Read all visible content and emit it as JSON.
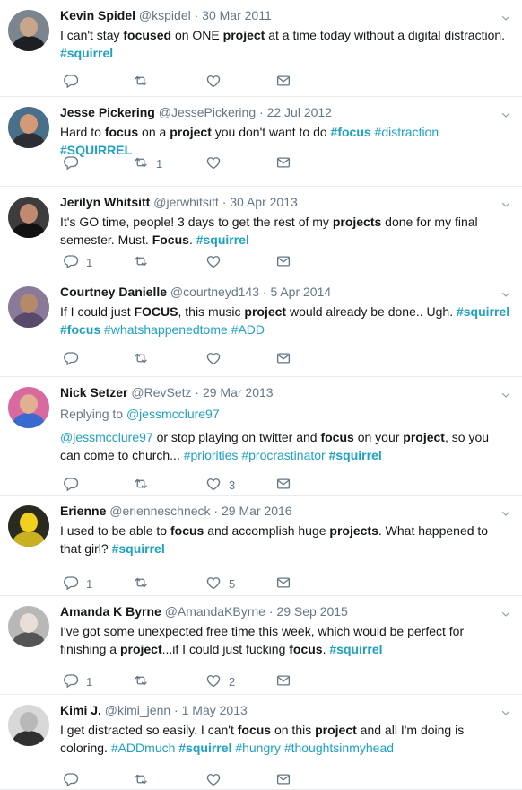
{
  "tweets": [
    {
      "name": "Kevin Spidel",
      "handle": "@kspidel",
      "date": "30 Mar 2011",
      "reply_to": "",
      "body": [
        {
          "t": "I can't stay "
        },
        {
          "t": "focused",
          "b": true
        },
        {
          "t": " on ONE "
        },
        {
          "t": "project",
          "b": true
        },
        {
          "t": " at a time today without a digital distraction. "
        },
        {
          "t": "#squirrel",
          "tag": true,
          "b": true
        }
      ],
      "replies": "",
      "retweets": "",
      "likes": "",
      "avatar": {
        "bg": "#7a8590",
        "face": "#c9a58a",
        "shoulders": "#1d1f22"
      }
    },
    {
      "name": "Jesse Pickering",
      "handle": "@JessePickering",
      "date": "22 Jul 2012",
      "reply_to": "",
      "body": [
        {
          "t": "Hard to "
        },
        {
          "t": "focus",
          "b": true
        },
        {
          "t": " on a "
        },
        {
          "t": "project",
          "b": true
        },
        {
          "t": " you don't want to do "
        },
        {
          "t": "#focus",
          "tag": true,
          "b": true
        },
        {
          "t": " "
        },
        {
          "t": "#distraction",
          "tag": true
        },
        {
          "t": " "
        },
        {
          "t": "#SQUIRREL",
          "tag": true,
          "b": true
        }
      ],
      "replies": "",
      "retweets": "1",
      "likes": "",
      "avatar": {
        "bg": "#4a6f8a",
        "face": "#d49a78",
        "shoulders": "#2b2f35"
      }
    },
    {
      "name": "Jerilyn Whitsitt",
      "handle": "@jerwhitsitt",
      "date": "30 Apr 2013",
      "reply_to": "",
      "body": [
        {
          "t": "It's GO time, people!  3 days to get the rest of my "
        },
        {
          "t": "projects",
          "b": true
        },
        {
          "t": " done for my final semester.  Must. "
        },
        {
          "t": "Focus",
          "b": true
        },
        {
          "t": ". "
        },
        {
          "t": "#squirrel",
          "tag": true,
          "b": true
        }
      ],
      "replies": "1",
      "retweets": "",
      "likes": "",
      "avatar": {
        "bg": "#3c3c3c",
        "face": "#c08a70",
        "shoulders": "#111111"
      }
    },
    {
      "name": "Courtney Danielle",
      "handle": "@courtneyd143",
      "date": "5 Apr 2014",
      "reply_to": "",
      "body": [
        {
          "t": "If I could just "
        },
        {
          "t": "FOCUS",
          "b": true
        },
        {
          "t": ", this music "
        },
        {
          "t": "project",
          "b": true
        },
        {
          "t": " would already be done.. Ugh. "
        },
        {
          "t": "#squirrel",
          "tag": true,
          "b": true
        },
        {
          "t": " "
        },
        {
          "t": "#focus",
          "tag": true,
          "b": true
        },
        {
          "t": " "
        },
        {
          "t": "#whatshappenedtome",
          "tag": true
        },
        {
          "t": " "
        },
        {
          "t": "#ADD",
          "tag": true
        }
      ],
      "replies": "",
      "retweets": "",
      "likes": "",
      "avatar": {
        "bg": "#8a7a9a",
        "face": "#b48a6a",
        "shoulders": "#5a4a6a"
      }
    },
    {
      "name": "Nick Setzer",
      "handle": "@RevSetz",
      "date": "29 Mar 2013",
      "reply_to_label": "Replying to ",
      "reply_to": "@jessmcclure97",
      "body": [
        {
          "t": "@jessmcclure97",
          "tag": true
        },
        {
          "t": " or stop playing on twitter and "
        },
        {
          "t": "focus",
          "b": true
        },
        {
          "t": " on your "
        },
        {
          "t": "project",
          "b": true
        },
        {
          "t": ", so you can come to church... "
        },
        {
          "t": "#priorities",
          "tag": true
        },
        {
          "t": " "
        },
        {
          "t": "#procrastinator",
          "tag": true
        },
        {
          "t": " "
        },
        {
          "t": "#squirrel",
          "tag": true,
          "b": true
        }
      ],
      "replies": "",
      "retweets": "",
      "likes": "3",
      "avatar": {
        "bg": "#d96aa0",
        "face": "#e0b090",
        "shoulders": "#3a6ad0"
      }
    },
    {
      "name": "Erienne",
      "handle": "@erienneschneck",
      "date": "29 Mar 2016",
      "reply_to": "",
      "body": [
        {
          "t": "I used to be able to "
        },
        {
          "t": "focus",
          "b": true
        },
        {
          "t": " and accomplish huge "
        },
        {
          "t": "projects",
          "b": true
        },
        {
          "t": ".  What happened to that girl? "
        },
        {
          "t": "#squirrel",
          "tag": true,
          "b": true
        }
      ],
      "replies": "1",
      "retweets": "",
      "likes": "5",
      "avatar": {
        "bg": "#2a2a20",
        "face": "#f2d020",
        "shoulders": "#c8b020"
      }
    },
    {
      "name": "Amanda K Byrne",
      "handle": "@AmandaKByrne",
      "date": "29 Sep 2015",
      "reply_to": "",
      "body": [
        {
          "t": "I've got some unexpected free time this week, which would be perfect for finishing a "
        },
        {
          "t": "project",
          "b": true
        },
        {
          "t": "...if I could just fucking "
        },
        {
          "t": "focus",
          "b": true
        },
        {
          "t": ". "
        },
        {
          "t": "#squirrel",
          "tag": true,
          "b": true
        }
      ],
      "replies": "1",
      "retweets": "",
      "likes": "2",
      "avatar": {
        "bg": "#b8b8b8",
        "face": "#e8e0d8",
        "shoulders": "#555555"
      }
    },
    {
      "name": "Kimi J.",
      "handle": "@kimi_jenn",
      "date": "1 May 2013",
      "reply_to": "",
      "body": [
        {
          "t": "I get distracted so easily. I can't "
        },
        {
          "t": "focus",
          "b": true
        },
        {
          "t": " on this "
        },
        {
          "t": "project",
          "b": true
        },
        {
          "t": " and all I'm doing is coloring. "
        },
        {
          "t": "#ADDmuch",
          "tag": true
        },
        {
          "t": " "
        },
        {
          "t": "#squirrel",
          "tag": true,
          "b": true
        },
        {
          "t": " "
        },
        {
          "t": "#hungry",
          "tag": true
        },
        {
          "t": " "
        },
        {
          "t": "#thoughtsinmyhead",
          "tag": true
        }
      ],
      "replies": "",
      "retweets": "",
      "likes": "",
      "avatar": {
        "bg": "#d8d8d8",
        "face": "#b8b8b8",
        "shoulders": "#303030"
      }
    }
  ]
}
